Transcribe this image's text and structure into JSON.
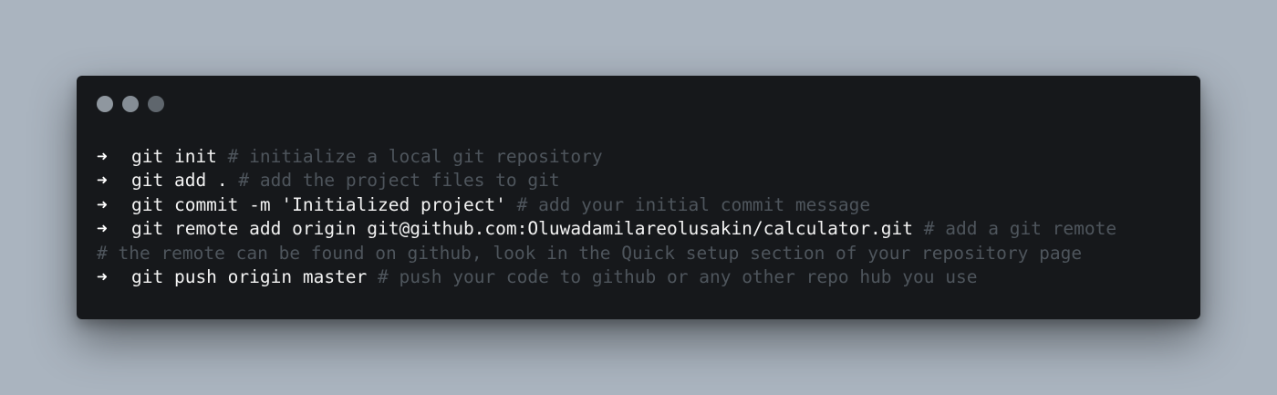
{
  "terminal": {
    "prompt_symbol": "➜",
    "lines": [
      {
        "command": "git init",
        "comment": "# initialize a local git repository"
      },
      {
        "command": "git add .",
        "comment": "# add the project files to git"
      },
      {
        "command": "git commit -m 'Initialized project'",
        "comment": "# add your initial commit message"
      },
      {
        "command": "git remote add origin git@github.com:Oluwadamilareolusakin/calculator.git",
        "comment": "# add a git remote"
      },
      {
        "comment": "# the remote can be found on github, look in the Quick setup section of your repository page"
      },
      {
        "command": "git push origin master",
        "comment": "# push your code to github or any other repo hub you use"
      }
    ]
  }
}
